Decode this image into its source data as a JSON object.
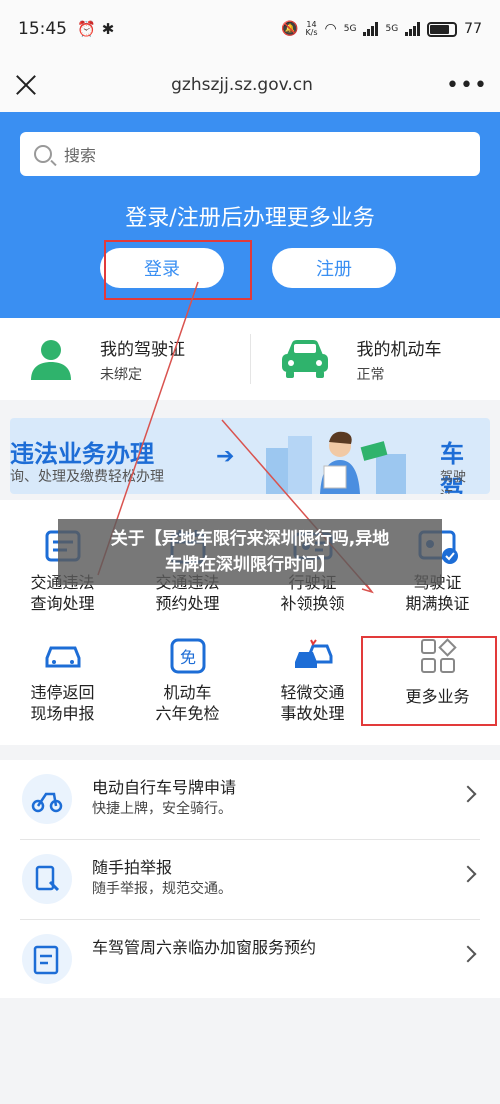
{
  "status_bar": {
    "time": "15:45",
    "speed_value": "14",
    "speed_unit": "K/s",
    "net1": "5G",
    "net2": "5G",
    "battery": "77",
    "battery_level": 0.77
  },
  "browser": {
    "url": "gzhszjj.sz.gov.cn"
  },
  "hero": {
    "search_placeholder": "搜索",
    "headline": "登录/注册后办理更多业务",
    "login_label": "登录",
    "register_label": "注册"
  },
  "licenses": [
    {
      "title": "我的驾驶证",
      "status": "未绑定"
    },
    {
      "title": "我的机动车",
      "status": "正常"
    }
  ],
  "banner": {
    "title": "违法业务办理",
    "subtitle": "询、处理及缴费轻松办理",
    "right_title": "车 驾",
    "right_subtitle": "驾驶证、"
  },
  "services": [
    {
      "line1": "交通违法",
      "line2": "查询处理",
      "icon": "ticket-icon"
    },
    {
      "line1": "交通违法",
      "line2": "预约处理",
      "icon": "calendar-icon"
    },
    {
      "line1": "行驶证",
      "line2": "补领换领",
      "icon": "card-icon"
    },
    {
      "line1": "驾驶证",
      "line2": "期满换证",
      "icon": "license-icon"
    },
    {
      "line1": "违停返回",
      "line2": "现场申报",
      "icon": "car-report-icon"
    },
    {
      "line1": "机动车",
      "line2": "六年免检",
      "icon": "exempt-icon"
    },
    {
      "line1": "轻微交通",
      "line2": "事故处理",
      "icon": "accident-icon"
    },
    {
      "line1": "更多业务",
      "line2": "",
      "icon": "more-grid-icon"
    }
  ],
  "overlay_caption": {
    "line1": "关于【异地车限行来深圳限行吗,异地",
    "line2": "车牌在深圳限行时间】"
  },
  "list": [
    {
      "title": "电动自行车号牌申请",
      "subtitle": "快捷上牌，安全骑行。",
      "icon": "scooter-icon"
    },
    {
      "title": "随手拍举报",
      "subtitle": "随手举报，规范交通。",
      "icon": "report-icon"
    },
    {
      "title": "车驾管周六亲临办加窗服务预约",
      "subtitle": "",
      "icon": "appointment-icon"
    }
  ],
  "colors": {
    "brand_blue": "#3a8ff2",
    "highlight_red": "#e23a3a",
    "green": "#2fb36c"
  }
}
